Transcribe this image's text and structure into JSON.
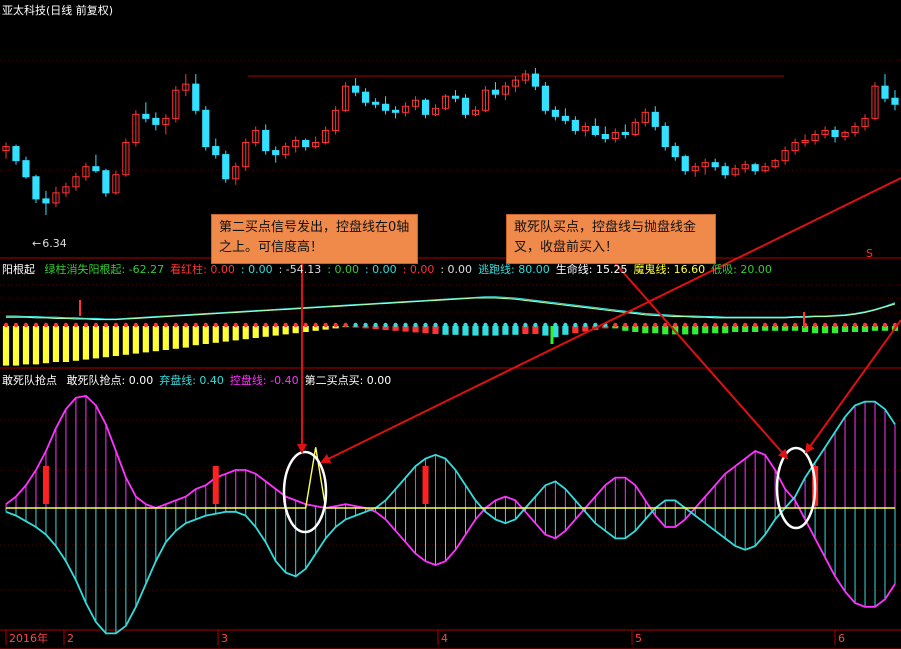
{
  "main": {
    "title": "亚太科技(日线 前复权)",
    "low_label": "6.34",
    "low_arrow": "←"
  },
  "indicator1": {
    "name": "阳根起",
    "items": [
      {
        "label": "绿柱消失阳根起: -62.27",
        "color": "#33cc33"
      },
      {
        "label": "看红柱: 0.00",
        "color": "#ff3333"
      },
      {
        "label": ": 0.00",
        "color": "#33dddd"
      },
      {
        "label": ": -54.13",
        "color": "#dddddd"
      },
      {
        "label": ": 0.00",
        "color": "#33cc33"
      },
      {
        "label": ": 0.00",
        "color": "#33dddd"
      },
      {
        "label": ": 0.00",
        "color": "#ff3333"
      },
      {
        "label": ": 0.00",
        "color": "#dddddd"
      },
      {
        "label": "逃跑线: 80.00",
        "color": "#33dddd"
      },
      {
        "label": "生命线: 15.25",
        "color": "#ffffff"
      },
      {
        "label": "魔鬼线: 16.60",
        "color": "#ffff33"
      },
      {
        "label": "低吸: 20.00",
        "color": "#33cc33"
      }
    ]
  },
  "indicator2": {
    "name": "敢死队抢点",
    "items": [
      {
        "label": "敢死队抢点: 0.00",
        "color": "#ffffff"
      },
      {
        "label": "弃盘线: 0.40",
        "color": "#33dddd"
      },
      {
        "label": "控盘线: -0.40",
        "color": "#ff33ff"
      },
      {
        "label": "第二买点买: 0.00",
        "color": "#ffffff"
      }
    ]
  },
  "annotations": [
    {
      "text": "第二买点信号发出，控盘线在0轴之上。可信度高！"
    },
    {
      "text": "敢死队买点，控盘线与抛盘线金叉，收盘前买入！"
    }
  ],
  "signal_mark": "S",
  "x_axis": {
    "labels": [
      "2016年",
      "2",
      "3",
      "4",
      "5",
      "6"
    ]
  },
  "colors": {
    "up": "#ff3333",
    "down": "#33e0ff",
    "grid": "#b00000",
    "ctrl": "#ff33ff",
    "aband": "#33dddd",
    "sig": "#ffff55",
    "arrow": "#dd1111"
  },
  "chart_data": {
    "type": "candlestick",
    "price_low": 6.34,
    "candles": [
      [
        15.2,
        15.6,
        14.8,
        15.4
      ],
      [
        15.4,
        15.5,
        14.5,
        14.7
      ],
      [
        14.7,
        14.9,
        13.8,
        13.9
      ],
      [
        13.9,
        14.0,
        12.6,
        12.8
      ],
      [
        12.8,
        13.2,
        12.0,
        12.6
      ],
      [
        12.6,
        13.4,
        12.4,
        13.1
      ],
      [
        13.1,
        13.6,
        12.9,
        13.4
      ],
      [
        13.4,
        14.1,
        13.2,
        13.9
      ],
      [
        13.9,
        14.6,
        13.7,
        14.4
      ],
      [
        14.4,
        15.0,
        14.1,
        14.2
      ],
      [
        14.2,
        14.3,
        12.9,
        13.1
      ],
      [
        13.1,
        14.2,
        13.0,
        14.0
      ],
      [
        14.0,
        15.8,
        13.9,
        15.6
      ],
      [
        15.6,
        17.2,
        15.4,
        17.0
      ],
      [
        17.0,
        17.6,
        16.6,
        16.8
      ],
      [
        16.8,
        17.1,
        16.2,
        16.5
      ],
      [
        16.5,
        17.0,
        16.0,
        16.8
      ],
      [
        16.8,
        18.4,
        16.6,
        18.2
      ],
      [
        18.2,
        19.0,
        17.9,
        18.5
      ],
      [
        18.5,
        19.0,
        17.0,
        17.2
      ],
      [
        17.2,
        17.4,
        15.2,
        15.4
      ],
      [
        15.4,
        15.8,
        14.8,
        15.0
      ],
      [
        15.0,
        15.2,
        13.6,
        13.8
      ],
      [
        13.8,
        14.6,
        13.5,
        14.4
      ],
      [
        14.4,
        15.8,
        14.2,
        15.6
      ],
      [
        15.6,
        16.4,
        15.4,
        16.2
      ],
      [
        16.2,
        16.5,
        15.0,
        15.2
      ],
      [
        15.2,
        15.4,
        14.6,
        15.0
      ],
      [
        15.0,
        15.6,
        14.8,
        15.4
      ],
      [
        15.4,
        15.9,
        15.1,
        15.7
      ],
      [
        15.7,
        15.8,
        15.2,
        15.4
      ],
      [
        15.4,
        15.9,
        15.3,
        15.6
      ],
      [
        15.6,
        16.4,
        15.5,
        16.2
      ],
      [
        16.2,
        17.4,
        16.0,
        17.2
      ],
      [
        17.2,
        18.6,
        17.1,
        18.4
      ],
      [
        18.4,
        18.8,
        17.9,
        18.1
      ],
      [
        18.1,
        18.3,
        17.4,
        17.6
      ],
      [
        17.6,
        17.8,
        17.3,
        17.5
      ],
      [
        17.5,
        17.9,
        17.0,
        17.2
      ],
      [
        17.2,
        17.4,
        16.8,
        17.1
      ],
      [
        17.1,
        17.6,
        16.9,
        17.4
      ],
      [
        17.4,
        17.9,
        17.2,
        17.7
      ],
      [
        17.7,
        17.8,
        16.8,
        17.0
      ],
      [
        17.0,
        17.5,
        16.9,
        17.3
      ],
      [
        17.3,
        18.0,
        17.2,
        17.9
      ],
      [
        17.9,
        18.2,
        17.6,
        17.8
      ],
      [
        17.8,
        18.0,
        16.8,
        17.0
      ],
      [
        17.0,
        17.4,
        16.9,
        17.2
      ],
      [
        17.2,
        18.4,
        17.1,
        18.2
      ],
      [
        18.2,
        18.6,
        17.8,
        18.0
      ],
      [
        18.0,
        18.6,
        17.7,
        18.4
      ],
      [
        18.4,
        18.9,
        18.1,
        18.7
      ],
      [
        18.7,
        19.2,
        18.5,
        19.0
      ],
      [
        19.0,
        19.3,
        18.2,
        18.4
      ],
      [
        18.4,
        18.6,
        17.0,
        17.2
      ],
      [
        17.2,
        17.4,
        16.7,
        16.9
      ],
      [
        16.9,
        17.3,
        16.5,
        16.7
      ],
      [
        16.7,
        16.9,
        16.0,
        16.2
      ],
      [
        16.2,
        16.6,
        15.9,
        16.4
      ],
      [
        16.4,
        16.8,
        15.9,
        16.0
      ],
      [
        16.0,
        16.4,
        15.6,
        15.8
      ],
      [
        15.8,
        16.3,
        15.6,
        16.1
      ],
      [
        16.1,
        16.5,
        15.8,
        16.0
      ],
      [
        16.0,
        16.8,
        15.9,
        16.6
      ],
      [
        16.6,
        17.3,
        16.4,
        17.1
      ],
      [
        17.1,
        17.4,
        16.2,
        16.4
      ],
      [
        16.4,
        16.6,
        15.2,
        15.4
      ],
      [
        15.4,
        15.6,
        14.7,
        14.9
      ],
      [
        14.9,
        15.0,
        14.0,
        14.2
      ],
      [
        14.2,
        14.6,
        13.9,
        14.4
      ],
      [
        14.4,
        14.8,
        14.0,
        14.6
      ],
      [
        14.6,
        14.8,
        14.2,
        14.4
      ],
      [
        14.4,
        14.6,
        13.8,
        14.0
      ],
      [
        14.0,
        14.5,
        13.9,
        14.3
      ],
      [
        14.3,
        14.7,
        14.1,
        14.5
      ],
      [
        14.5,
        14.6,
        14.0,
        14.2
      ],
      [
        14.2,
        14.6,
        14.1,
        14.4
      ],
      [
        14.4,
        14.8,
        14.3,
        14.7
      ],
      [
        14.7,
        15.4,
        14.5,
        15.2
      ],
      [
        15.2,
        15.8,
        15.0,
        15.6
      ],
      [
        15.6,
        16.0,
        15.4,
        15.7
      ],
      [
        15.7,
        16.2,
        15.5,
        16.0
      ],
      [
        16.0,
        16.4,
        15.8,
        16.2
      ],
      [
        16.2,
        16.4,
        15.6,
        15.9
      ],
      [
        15.9,
        16.2,
        15.7,
        16.1
      ],
      [
        16.1,
        16.6,
        15.9,
        16.4
      ],
      [
        16.4,
        17.0,
        16.2,
        16.8
      ],
      [
        16.8,
        18.6,
        16.7,
        18.4
      ],
      [
        18.4,
        19.0,
        17.6,
        17.8
      ],
      [
        17.8,
        18.2,
        17.2,
        17.5
      ]
    ],
    "ctrl_line": [
      0.1,
      0.3,
      0.6,
      1.0,
      1.5,
      2.1,
      2.6,
      2.9,
      2.95,
      2.7,
      2.2,
      1.5,
      0.8,
      0.3,
      0.1,
      0.0,
      0.1,
      0.2,
      0.3,
      0.5,
      0.6,
      0.8,
      0.9,
      1.0,
      1.0,
      0.9,
      0.7,
      0.5,
      0.3,
      0.2,
      0.1,
      0.05,
      0.0,
      0.05,
      0.1,
      0.05,
      0.0,
      -0.1,
      -0.3,
      -0.6,
      -0.9,
      -1.2,
      -1.4,
      -1.5,
      -1.4,
      -1.1,
      -0.7,
      -0.3,
      0.0,
      0.2,
      0.3,
      0.2,
      -0.1,
      -0.4,
      -0.7,
      -0.8,
      -0.6,
      -0.3,
      0.0,
      0.3,
      0.6,
      0.8,
      0.8,
      0.6,
      0.2,
      -0.2,
      -0.5,
      -0.5,
      -0.3,
      0.0,
      0.3,
      0.6,
      0.9,
      1.1,
      1.3,
      1.5,
      1.4,
      1.0,
      0.5,
      0.2,
      -0.3,
      -0.8,
      -1.3,
      -1.8,
      -2.2,
      -2.5,
      -2.6,
      -2.6,
      -2.4,
      -2.0
    ],
    "abandon_line": [
      -0.1,
      -0.2,
      -0.35,
      -0.5,
      -0.7,
      -1.0,
      -1.4,
      -1.9,
      -2.5,
      -3.0,
      -3.3,
      -3.3,
      -3.1,
      -2.6,
      -2.0,
      -1.4,
      -0.9,
      -0.6,
      -0.4,
      -0.3,
      -0.2,
      -0.15,
      -0.1,
      -0.1,
      -0.2,
      -0.5,
      -0.9,
      -1.4,
      -1.7,
      -1.8,
      -1.6,
      -1.2,
      -0.8,
      -0.5,
      -0.3,
      -0.2,
      -0.1,
      0.0,
      0.2,
      0.5,
      0.8,
      1.1,
      1.3,
      1.4,
      1.3,
      1.0,
      0.6,
      0.2,
      -0.1,
      -0.3,
      -0.4,
      -0.3,
      0.0,
      0.3,
      0.6,
      0.7,
      0.5,
      0.2,
      -0.1,
      -0.4,
      -0.6,
      -0.8,
      -0.8,
      -0.6,
      -0.3,
      0.0,
      0.2,
      0.2,
      0.0,
      -0.2,
      -0.4,
      -0.6,
      -0.8,
      -1.0,
      -1.1,
      -1.0,
      -0.7,
      -0.3,
      0.0,
      0.3,
      0.8,
      1.2,
      1.6,
      2.0,
      2.4,
      2.7,
      2.8,
      2.8,
      2.6,
      2.2
    ],
    "second_buy_line": [
      0,
      0,
      0,
      0,
      0,
      0,
      0,
      0,
      0,
      0,
      0,
      0,
      0,
      0,
      0,
      0,
      0,
      0,
      0,
      0,
      0,
      0,
      0,
      0,
      0,
      0,
      0,
      0,
      0,
      0,
      0,
      1.6,
      0,
      0,
      0,
      0,
      0,
      0,
      0,
      0,
      0,
      0,
      0,
      0,
      0,
      0,
      0,
      0,
      0,
      0,
      0,
      0,
      0,
      0,
      0,
      0,
      0,
      0,
      0,
      0,
      0,
      0,
      0,
      0,
      0,
      0,
      0,
      0,
      0,
      0,
      0,
      0,
      0,
      0,
      0,
      0,
      0,
      0,
      0,
      0,
      0,
      0,
      0,
      0,
      0,
      0,
      0,
      0,
      0,
      0
    ],
    "buy_signals": [
      4,
      21,
      42,
      81
    ],
    "ind1_bars": [
      -3.3,
      -3.3,
      -3.2,
      -3.2,
      -3.1,
      -3.0,
      -3.0,
      -2.9,
      -2.8,
      -2.7,
      -2.6,
      -2.5,
      -2.4,
      -2.3,
      -2.2,
      -2.1,
      -2.0,
      -1.9,
      -1.8,
      -1.6,
      -1.5,
      -1.4,
      -1.3,
      -1.2,
      -1.1,
      -1.0,
      -0.9,
      -0.8,
      -0.7,
      -0.6,
      -0.5,
      -0.4,
      -0.3,
      -0.2,
      -0.1,
      0.2,
      0.3,
      0.4,
      0.5,
      0.6,
      0.7,
      0.8,
      0.9,
      1.0,
      1.1,
      1.1,
      1.2,
      1.2,
      1.2,
      1.2,
      1.1,
      1.1,
      1.0,
      1.0,
      1.2,
      1.4,
      1.1,
      0.9,
      0.7,
      0.5,
      0.3,
      -0.2,
      -0.4,
      -0.5,
      -0.6,
      -0.6,
      -0.7,
      -0.7,
      -0.7,
      -0.7,
      -0.6,
      -0.6,
      -0.6,
      -0.5,
      -0.5,
      -0.5,
      -0.4,
      -0.4,
      -0.4,
      -0.4,
      -0.5,
      -0.6,
      -0.6,
      -0.6,
      -0.5,
      -0.5,
      -0.5,
      -0.4,
      -0.4,
      -0.4
    ],
    "ind1_line_a": [
      60,
      60,
      59,
      59,
      58,
      58,
      57,
      57,
      56,
      56,
      55,
      55,
      56,
      57,
      58,
      59,
      60,
      61,
      62,
      63,
      64,
      65,
      66,
      67,
      68,
      69,
      70,
      71,
      72,
      73,
      74,
      75,
      76,
      77,
      78,
      79,
      80,
      81,
      82,
      83,
      84,
      85,
      86,
      87,
      88,
      89,
      90,
      91,
      92,
      92,
      91,
      90,
      88,
      86,
      84,
      82,
      80,
      78,
      76,
      74,
      72,
      70,
      68,
      66,
      64,
      63,
      62,
      61,
      60,
      60,
      59,
      59,
      58,
      58,
      58,
      58,
      58,
      58,
      58,
      59,
      59,
      60,
      60,
      61,
      62,
      64,
      67,
      71,
      76,
      82
    ],
    "ind1_line_b": [
      58,
      58,
      58,
      57,
      57,
      56,
      56,
      55,
      55,
      54,
      54,
      54,
      55,
      56,
      57,
      58,
      59,
      60,
      61,
      62,
      63,
      64,
      65,
      66,
      67,
      68,
      69,
      70,
      71,
      72,
      73,
      74,
      75,
      76,
      77,
      78,
      79,
      80,
      81,
      82,
      83,
      84,
      85,
      86,
      87,
      88,
      89,
      90,
      90,
      90,
      89,
      88,
      86,
      84,
      82,
      80,
      78,
      76,
      74,
      72,
      70,
      68,
      66,
      64,
      62,
      61,
      60,
      59,
      59,
      58,
      58,
      57,
      57,
      57,
      57,
      57,
      57,
      57,
      57,
      58,
      58,
      59,
      59,
      60,
      61,
      63,
      66,
      70,
      75,
      80
    ]
  }
}
